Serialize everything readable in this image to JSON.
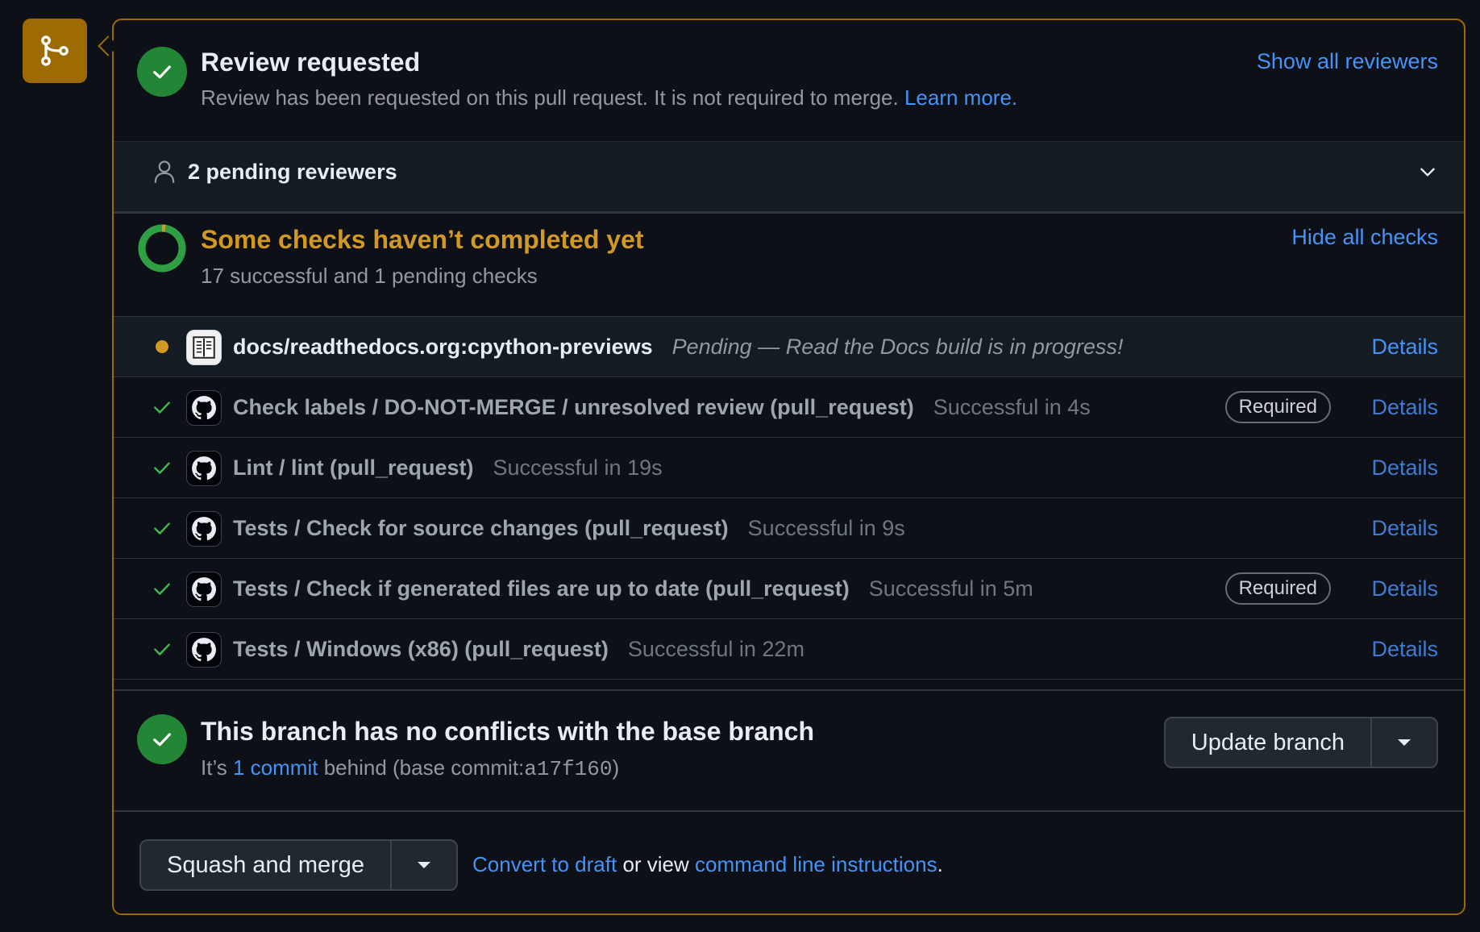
{
  "review": {
    "title": "Review requested",
    "subtitle": "Review has been requested on this pull request. It is not required to merge.",
    "learn_more": "Learn more.",
    "show_all_reviewers": "Show all reviewers",
    "pending_reviewers": "2 pending reviewers"
  },
  "checks": {
    "title": "Some checks haven’t completed yet",
    "subtitle": "17 successful and 1 pending checks",
    "hide_all": "Hide all checks",
    "rows": [
      {
        "name": "docs/readthedocs.org:cpython-previews",
        "desc": "Pending — Read the Docs build is in progress!",
        "required": "",
        "details": "Details",
        "status": "pending",
        "app_icon": "readthedocs-icon"
      },
      {
        "name": "Check labels / DO-NOT-MERGE / unresolved review (pull_request)",
        "desc": "Successful in 4s",
        "required": "Required",
        "details": "Details",
        "status": "success",
        "app_icon": "github-icon"
      },
      {
        "name": "Lint / lint (pull_request)",
        "desc": "Successful in 19s",
        "required": "",
        "details": "Details",
        "status": "success",
        "app_icon": "github-icon"
      },
      {
        "name": "Tests / Check for source changes (pull_request)",
        "desc": "Successful in 9s",
        "required": "",
        "details": "Details",
        "status": "success",
        "app_icon": "github-icon"
      },
      {
        "name": "Tests / Check if generated files are up to date (pull_request)",
        "desc": "Successful in 5m",
        "required": "Required",
        "details": "Details",
        "status": "success",
        "app_icon": "github-icon"
      },
      {
        "name": "Tests / Windows (x86) (pull_request)",
        "desc": "Successful in 22m",
        "required": "",
        "details": "Details",
        "status": "success",
        "app_icon": "github-icon"
      }
    ]
  },
  "branch": {
    "title": "This branch has no conflicts with the base branch",
    "its": "It’s",
    "commit_link": "1 commit",
    "behind": "behind (base commit:",
    "base_commit": "a17f160",
    "close_paren": ")",
    "update_button": "Update branch"
  },
  "merge": {
    "button": "Squash and merge",
    "convert_draft": "Convert to draft",
    "or_view": "or view",
    "cli_link": "command line instructions",
    "period": "."
  },
  "colors": {
    "accent_border": "#9e6a03",
    "success": "#238636",
    "pending": "#d29922",
    "link": "#4493f8"
  }
}
